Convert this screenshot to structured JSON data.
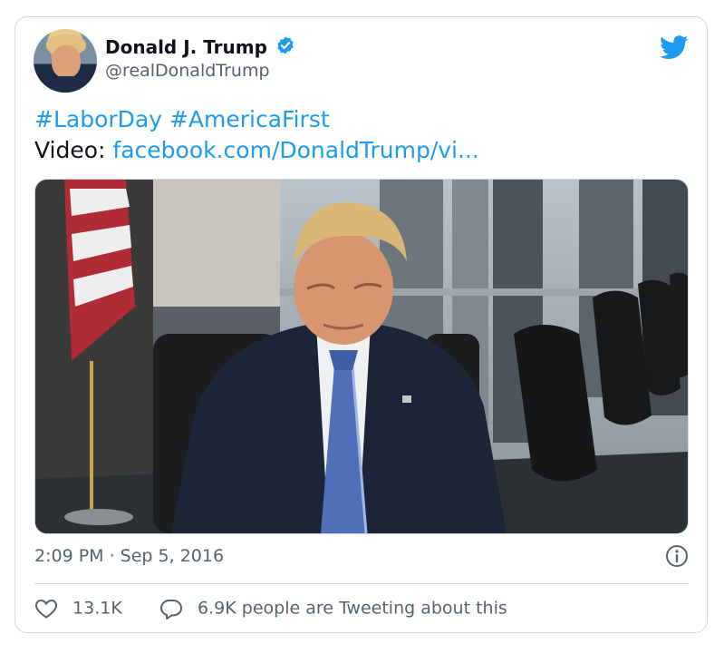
{
  "tweet": {
    "display_name": "Donald J. Trump",
    "handle": "@realDonaldTrump",
    "hashtag_1": "#LaborDay",
    "hashtag_2": "#AmericaFirst",
    "video_prefix": "Video:",
    "video_link": "facebook.com/DonaldTrump/vi...",
    "timestamp": "2:09 PM · Sep 5, 2016",
    "likes": "13.1K",
    "tweeting": "6.9K people are Tweeting about this"
  },
  "colors": {
    "link": "#1d9bf0",
    "verified": "#1d9bf0",
    "muted": "#536471",
    "border": "#cfd9de"
  },
  "icons": [
    "twitter-bird-icon",
    "verified-badge-icon",
    "info-icon",
    "heart-icon",
    "reply-bubble-icon"
  ]
}
